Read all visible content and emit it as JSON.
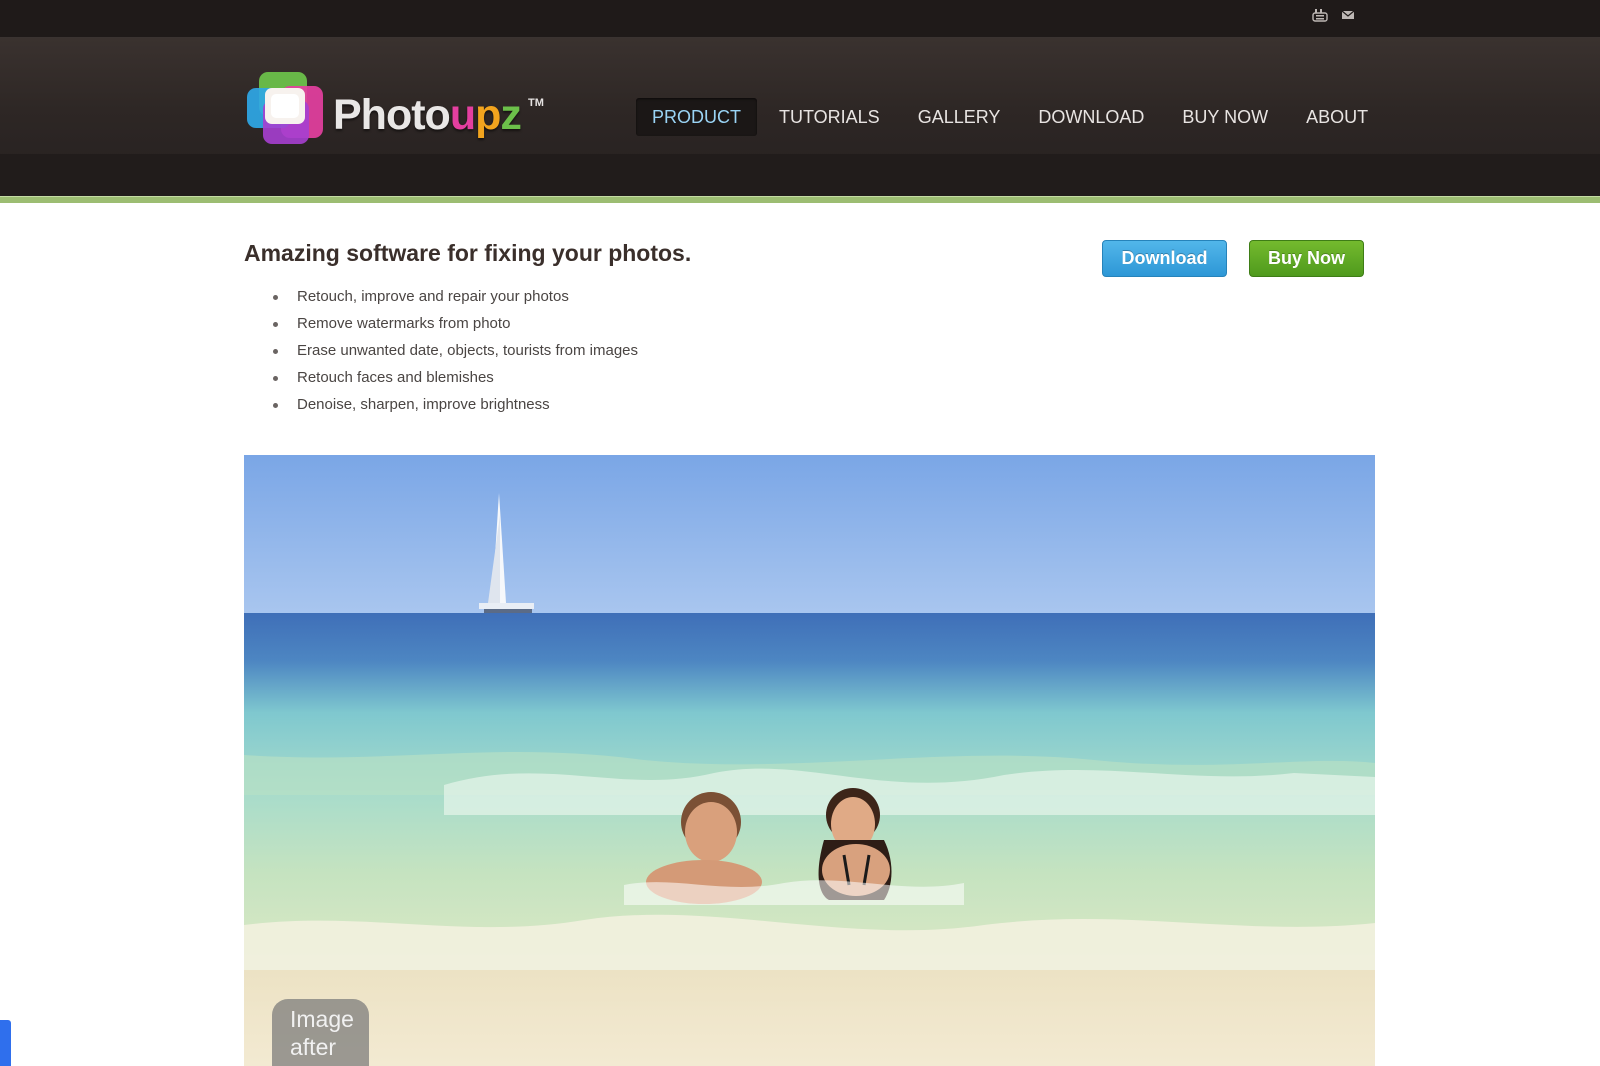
{
  "topbar": {
    "icons": [
      "youtube-icon",
      "mail-icon"
    ]
  },
  "logo": {
    "word_part1": "Photo",
    "word_u": "u",
    "word_p": "p",
    "word_z": "z",
    "trademark": "TM"
  },
  "nav": {
    "items": [
      {
        "label": "PRODUCT",
        "active": true
      },
      {
        "label": "TUTORIALS",
        "active": false
      },
      {
        "label": "GALLERY",
        "active": false
      },
      {
        "label": "DOWNLOAD",
        "active": false
      },
      {
        "label": "BUY NOW",
        "active": false
      },
      {
        "label": "ABOUT",
        "active": false
      }
    ]
  },
  "main": {
    "headline": "Amazing software for fixing your photos.",
    "features": [
      "Retouch, improve and repair your photos",
      "Remove watermarks from photo",
      "Erase unwanted date, objects, tourists from images",
      "Retouch faces and blemishes",
      "Denoise, sharpen, improve brightness"
    ],
    "download_button": "Download",
    "buy_button": "Buy Now"
  },
  "photo": {
    "label_line1": "Image",
    "label_line2": "after"
  },
  "colors": {
    "accent_blue": "#2d97d6",
    "accent_green": "#4f9a1d",
    "nav_active_text": "#9ad4f5",
    "green_rule": "#9cbd72"
  }
}
